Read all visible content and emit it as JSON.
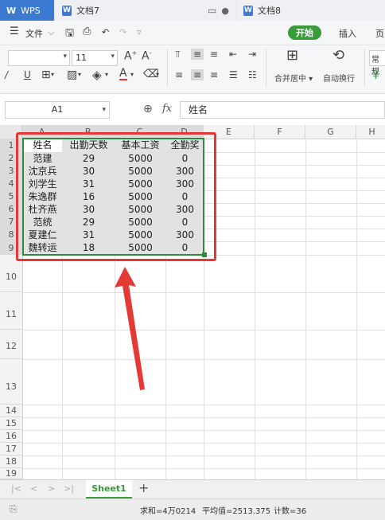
{
  "tabs": {
    "app": "WPS",
    "doc1": "文档7",
    "doc2": "文档8"
  },
  "menu": {
    "file": "文件",
    "start": "开始",
    "insert": "插入",
    "more": "页"
  },
  "ribbon": {
    "font_size": "11",
    "merge_center": "合并居中",
    "wrap_text": "自动换行",
    "normal": "常规"
  },
  "formula": {
    "cell_ref": "A1",
    "fx": "fx",
    "content": "姓名"
  },
  "columns": [
    "A",
    "B",
    "C",
    "D",
    "E",
    "F",
    "G",
    "H"
  ],
  "rows": [
    "1",
    "2",
    "3",
    "4",
    "5",
    "6",
    "7",
    "8",
    "9",
    "10",
    "11",
    "12",
    "13",
    "14",
    "15",
    "16",
    "17",
    "18",
    "19"
  ],
  "table": {
    "headers": [
      "姓名",
      "出勤天数",
      "基本工资",
      "全勤奖"
    ],
    "records": [
      [
        "范建",
        "29",
        "5000",
        "0"
      ],
      [
        "沈京兵",
        "30",
        "5000",
        "300"
      ],
      [
        "刘学生",
        "31",
        "5000",
        "300"
      ],
      [
        "朱逸群",
        "16",
        "5000",
        "0"
      ],
      [
        "杜齐燕",
        "30",
        "5000",
        "300"
      ],
      [
        "范统",
        "29",
        "5000",
        "0"
      ],
      [
        "夏建仁",
        "31",
        "5000",
        "300"
      ],
      [
        "魏转运",
        "18",
        "5000",
        "0"
      ]
    ]
  },
  "sheet": {
    "name": "Sheet1",
    "add": "+"
  },
  "status": {
    "sum": "求和=4万0214",
    "avg": "平均值=2513.375",
    "count": "计数=36"
  },
  "colors": {
    "accent_green": "#3a9b3a",
    "tab_blue": "#3c79d0",
    "annotation_red": "#e53935"
  }
}
